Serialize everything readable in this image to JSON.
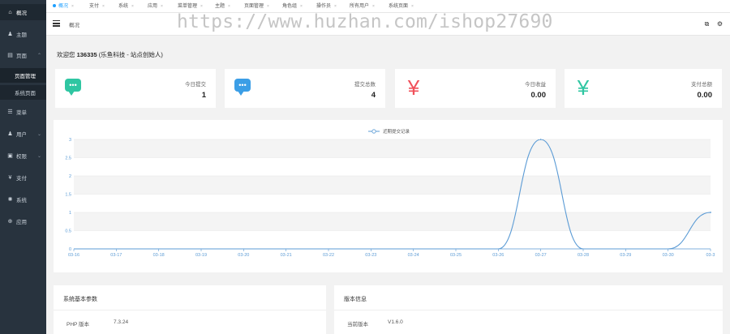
{
  "sidebar": {
    "items": [
      {
        "icon": "home-icon",
        "glyph": "⌂",
        "label": "概况",
        "active": true
      },
      {
        "icon": "shirt-icon",
        "glyph": "♟",
        "label": "主题"
      },
      {
        "icon": "page-icon",
        "glyph": "▤",
        "label": "页面",
        "caret": "⌄"
      },
      {
        "icon": "list-icon",
        "glyph": "☰",
        "label": "菜单"
      },
      {
        "icon": "user-icon",
        "glyph": "♟",
        "label": "用户",
        "caret": "⌄"
      },
      {
        "icon": "lock-icon",
        "glyph": "▣",
        "label": "权限",
        "caret": "⌄"
      },
      {
        "icon": "yen-icon",
        "glyph": "¥",
        "label": "支付"
      },
      {
        "icon": "gear-icon",
        "glyph": "✺",
        "label": "系统"
      },
      {
        "icon": "app-icon",
        "glyph": "⊕",
        "label": "应用"
      }
    ],
    "subitems": [
      "页面管理",
      "系统页面"
    ]
  },
  "tabs": [
    "概况",
    "支付",
    "系统",
    "应用",
    "菜单管理",
    "主题",
    "页面管理",
    "角色组",
    "操作员",
    "所有用户",
    "系统页面"
  ],
  "toolbar": {
    "breadcrumb": "概况"
  },
  "watermark": "https://www.huzhan.com/ishop27690",
  "welcome": {
    "prefix": "欢迎您 ",
    "user": "136335",
    "suffix": " (乐鱼科技 - 站点创始人)"
  },
  "cards": [
    {
      "label": "今日提交",
      "value": "1",
      "icon": "chat-bubble-icon",
      "color": "#2fc6a2"
    },
    {
      "label": "提交总数",
      "value": "4",
      "icon": "chat-bubble-icon",
      "color": "#3b9ee6"
    },
    {
      "label": "今日收益",
      "value": "0.00",
      "icon": "yen-icon",
      "color": "#f0505a"
    },
    {
      "label": "支付总额",
      "value": "0.00",
      "icon": "yen-icon",
      "color": "#2fc6a2"
    }
  ],
  "chart_data": {
    "type": "line",
    "legend": "近期提交记录",
    "legend_position": "top-center",
    "categories": [
      "03-16",
      "03-17",
      "03-18",
      "03-19",
      "03-20",
      "03-21",
      "03-22",
      "03-23",
      "03-24",
      "03-25",
      "03-26",
      "03-27",
      "03-28",
      "03-29",
      "03-30",
      "03-3"
    ],
    "series": [
      {
        "name": "近期提交记录",
        "values": [
          0,
          0,
          0,
          0,
          0,
          0,
          0,
          0,
          0,
          0,
          0,
          3,
          0,
          0,
          0,
          1
        ]
      }
    ],
    "y_ticks": [
      "0",
      "0.5",
      "1",
      "1.5",
      "2",
      "2.5",
      "3"
    ],
    "ylim": [
      0,
      3
    ],
    "color": "#5b9bd5",
    "grid": true
  },
  "system_panel": {
    "title": "系统基本参数",
    "rows": [
      {
        "label": "PHP 版本",
        "value": "7.3.24"
      }
    ]
  },
  "version_panel": {
    "title": "版本信息",
    "rows": [
      {
        "label": "当前版本",
        "value": "V1.6.0"
      }
    ]
  }
}
